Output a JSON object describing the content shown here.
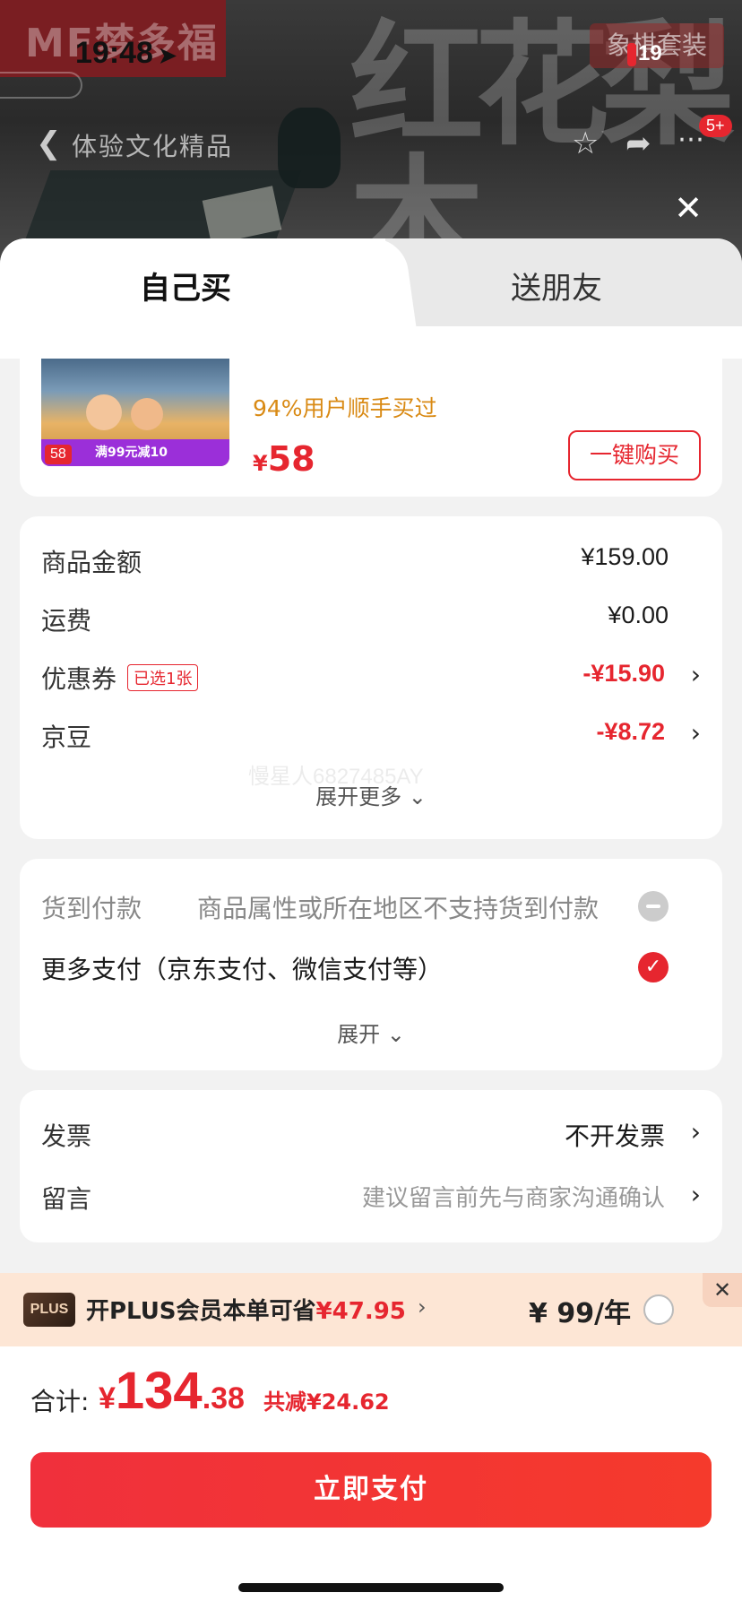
{
  "status": {
    "time": "19:48",
    "badge": "19"
  },
  "hero": {
    "brand": "MF梦多福",
    "calligraphy": "红花梨木",
    "set_tag": "象棋套装",
    "nav_title": "体验文化精品",
    "cart_count": "5+"
  },
  "tabs": {
    "self": "自己买",
    "gift": "送朋友"
  },
  "product": {
    "rate_text": "94%用户顺手买过",
    "price_symbol": "¥",
    "price": "58",
    "buy_button": "一键购买",
    "img_price": "58",
    "img_promo": "满99元减10"
  },
  "amounts": {
    "items": [
      {
        "label": "商品金额",
        "value": "¥159.00"
      },
      {
        "label": "运费",
        "value": "¥0.00"
      },
      {
        "label": "优惠券",
        "badge": "已选1张",
        "value": "-¥15.90"
      },
      {
        "label": "京豆",
        "value": "-¥8.72"
      }
    ],
    "expand": "展开更多",
    "watermark": "慢星人6827485AY"
  },
  "payment": {
    "cod_label": "货到付款",
    "cod_note": "商品属性或所在地区不支持货到付款",
    "more_label": "更多支付（京东支付、微信支付等）",
    "expand": "展开"
  },
  "invoice": {
    "invoice_label": "发票",
    "invoice_value": "不开发票",
    "note_label": "留言",
    "note_placeholder": "建议留言前先与商家沟通确认"
  },
  "plus": {
    "logo": "PLUS",
    "text_prefix": "开PLUS会员本单可省",
    "save_amount": "¥47.95",
    "price": "¥ 99/年"
  },
  "footer": {
    "total_label": "合计:",
    "total_yen": "¥",
    "total_int": "134",
    "total_dec": ".38",
    "total_save": "共减¥24.62",
    "pay_button": "立即支付"
  },
  "colors": {
    "accent": "#e6262f",
    "plus_bg": "#fde6d5",
    "rate_orange": "#d98a14"
  }
}
